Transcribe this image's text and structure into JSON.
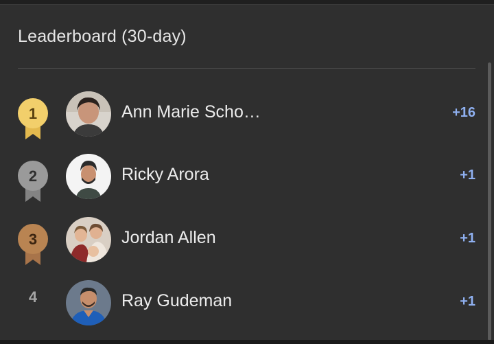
{
  "leaderboard": {
    "title": "Leaderboard (30-day)",
    "entries": [
      {
        "rank": "1",
        "name": "Ann Marie Scho…",
        "score": "+16",
        "badge_color": "#f2cf6b",
        "badge_text_color": "#5a4210"
      },
      {
        "rank": "2",
        "name": "Ricky Arora",
        "score": "+1",
        "badge_color": "#9a9a9a",
        "badge_text_color": "#2f2f2f"
      },
      {
        "rank": "3",
        "name": "Jordan Allen",
        "score": "+1",
        "badge_color": "#b98452",
        "badge_text_color": "#3b2410"
      },
      {
        "rank": "4",
        "name": "Ray Gudeman",
        "score": "+1"
      }
    ]
  },
  "colors": {
    "background": "#2f2f2f",
    "score": "#8fb0f0",
    "text": "#ececec"
  }
}
